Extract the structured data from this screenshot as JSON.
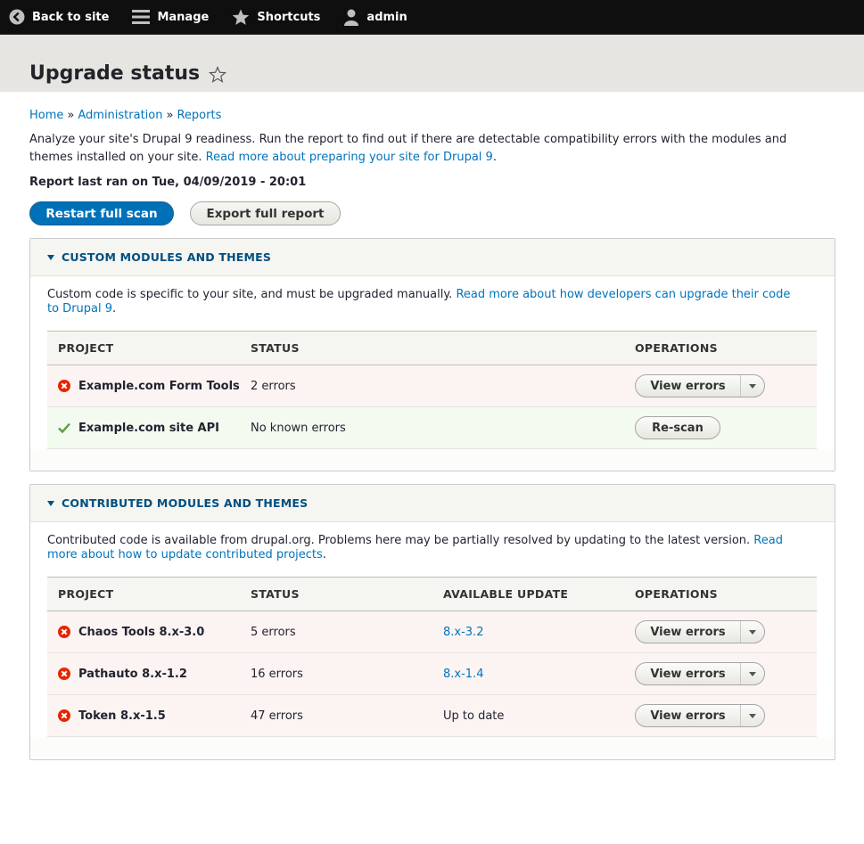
{
  "toolbar": {
    "back": "Back to site",
    "manage": "Manage",
    "shortcuts": "Shortcuts",
    "user": "admin"
  },
  "header": {
    "title": "Upgrade status"
  },
  "breadcrumb": [
    "Home",
    "Administration",
    "Reports"
  ],
  "intro": {
    "text": "Analyze your site's Drupal 9 readiness. Run the report to find out if there are detectable compatibility errors with the modules and themes installed on your site.",
    "link": "Read more about preparing your site for Drupal 9"
  },
  "last_run": "Report last ran on Tue, 04/09/2019 - 20:01",
  "actions": {
    "restart": "Restart full scan",
    "export": "Export full report"
  },
  "custom": {
    "title": "CUSTOM MODULES AND THEMES",
    "desc": "Custom code is specific to your site, and must be upgraded manually.",
    "link": "Read more about how developers can upgrade their code to Drupal 9",
    "headers": {
      "project": "PROJECT",
      "status": "STATUS",
      "operations": "OPERATIONS"
    },
    "rows": [
      {
        "project": "Example.com Form Tools",
        "status": "2 errors",
        "op": "View errors"
      },
      {
        "project": "Example.com site API",
        "status": "No known errors",
        "op": "Re-scan"
      }
    ]
  },
  "contrib": {
    "title": "CONTRIBUTED MODULES AND THEMES",
    "desc": "Contributed code is available from drupal.org. Problems here may be partially resolved by updating to the latest version.",
    "link": "Read more about how to update contributed projects",
    "headers": {
      "project": "PROJECT",
      "status": "STATUS",
      "update": "AVAILABLE UPDATE",
      "operations": "OPERATIONS"
    },
    "rows": [
      {
        "project": "Chaos Tools 8.x-3.0",
        "status": "5 errors",
        "update": "8.x-3.2",
        "op": "View errors"
      },
      {
        "project": "Pathauto 8.x-1.2",
        "status": "16 errors",
        "update": "8.x-1.4",
        "op": "View errors"
      },
      {
        "project": "Token 8.x-1.5",
        "status": "47 errors",
        "update": "Up to date",
        "op": "View errors"
      }
    ]
  },
  "colors": {
    "accent": "#0074bd",
    "primary_button": "#0071b8",
    "error": "#e32700",
    "success": "#5a9e3a"
  }
}
